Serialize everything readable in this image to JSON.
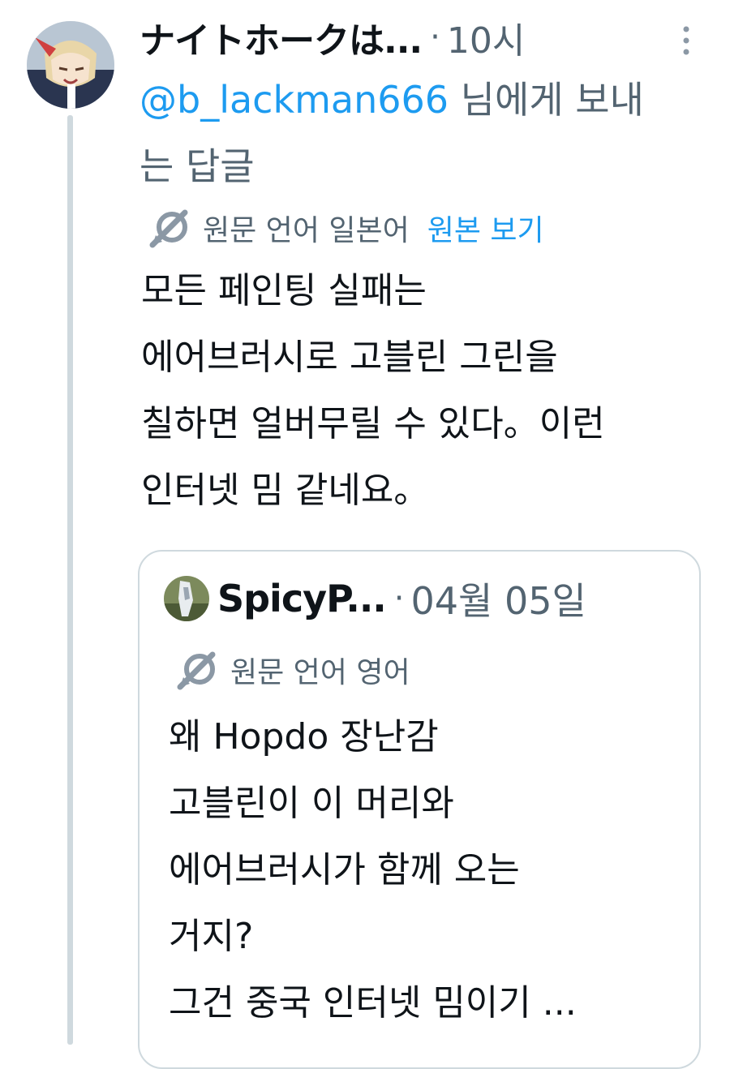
{
  "tweet": {
    "author_name": "ナイトホークは...",
    "separator": "·",
    "timestamp": "10시",
    "reply_handle": "@b_lackman666",
    "reply_suffix": " 님에게 보내는 답글",
    "translation": {
      "label": "원문 언어 일본어",
      "link": "원본 보기"
    },
    "body_lines": [
      "모든 페인팅 실패는",
      "에어브러시로 고블린 그린을",
      "칠하면 얼버무릴 수 있다。이런",
      "인터넷 밈 같네요。"
    ]
  },
  "quote": {
    "author_name": "SpicyP...",
    "separator": "·",
    "timestamp": "04월 05일",
    "translation": {
      "label": "원문 언어 영어"
    },
    "body_lines": [
      "왜 Hopdo 장난감",
      "고블린이 이 머리와",
      "에어브러시가 함께 오는",
      "거지?",
      "그건 중국 인터넷 밈이기 ..."
    ]
  },
  "colors": {
    "text": "#0f1419",
    "secondary": "#536471",
    "link": "#1d9bf0",
    "border": "#cfd9de"
  },
  "icons": {
    "translate": "translate-icon",
    "more": "more-vertical-icon"
  }
}
